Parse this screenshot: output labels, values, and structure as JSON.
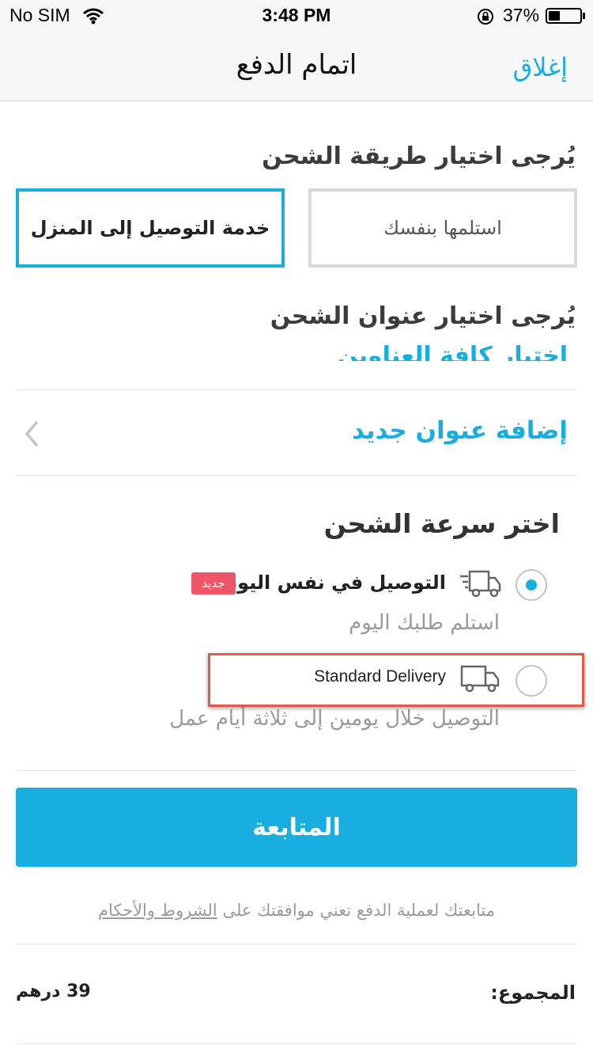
{
  "status_bar": {
    "carrier": "No SIM",
    "time": "3:48 PM",
    "battery": "37%",
    "battery_level": 0.37,
    "icons": [
      "wifi-icon",
      "orientation-lock-icon",
      "battery-icon"
    ]
  },
  "nav": {
    "title": "اتمام الدفع",
    "close_label": "إغلاق"
  },
  "shipping_method": {
    "title": "يُرجى اختيار طريقة الشحن",
    "options": [
      {
        "label": "خدمة التوصيل إلى المنزل",
        "selected": true
      },
      {
        "label": "استلمها بنفسك",
        "selected": false
      }
    ]
  },
  "shipping_address": {
    "title": "يُرجى اختيار عنوان الشحن",
    "clipped_link": "إختيار كافة العناوين",
    "add_new": "إضافة عنوان جديد"
  },
  "shipping_speed": {
    "title": "اختر سرعة الشحن",
    "options": [
      {
        "label": "التوصيل في نفس اليوم",
        "badge": "جديد",
        "subtitle": "استلم طلبك اليوم",
        "selected": true,
        "icon": "fast-truck-icon"
      },
      {
        "label": "Standard Delivery",
        "subtitle": "التوصيل خلال يومين إلى ثلاثة أيام عمل",
        "selected": false,
        "icon": "truck-icon"
      }
    ]
  },
  "actions": {
    "continue_label": "المتابعة"
  },
  "terms": {
    "prefix": "متابعتك لعملية الدفع تعني موافقتك على ",
    "link": "الشروط والأحكام"
  },
  "total": {
    "label": "المجموع:",
    "value": "39 درهم"
  },
  "colors": {
    "accent": "#18aee0",
    "badge": "#f0566a",
    "highlight": "#e05a47"
  }
}
